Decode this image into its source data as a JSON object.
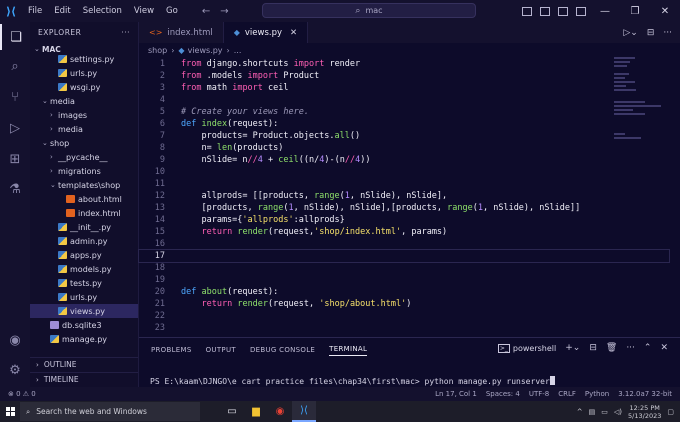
{
  "menu": [
    "File",
    "Edit",
    "Selection",
    "View",
    "Go"
  ],
  "search": {
    "placeholder": "mac"
  },
  "explorer": {
    "title": "EXPLORER",
    "root": "MAC",
    "items": [
      {
        "label": "settings.py",
        "indent": 2,
        "kind": "py"
      },
      {
        "label": "urls.py",
        "indent": 2,
        "kind": "py"
      },
      {
        "label": "wsgi.py",
        "indent": 2,
        "kind": "py"
      },
      {
        "label": "media",
        "indent": 1,
        "kind": "folder",
        "open": true
      },
      {
        "label": "images",
        "indent": 2,
        "kind": "folder",
        "open": false
      },
      {
        "label": "media",
        "indent": 2,
        "kind": "folder",
        "open": false
      },
      {
        "label": "shop",
        "indent": 1,
        "kind": "folder",
        "open": true
      },
      {
        "label": "__pycache__",
        "indent": 2,
        "kind": "folder",
        "open": false
      },
      {
        "label": "migrations",
        "indent": 2,
        "kind": "folder",
        "open": false
      },
      {
        "label": "templates\\shop",
        "indent": 2,
        "kind": "folder",
        "open": true
      },
      {
        "label": "about.html",
        "indent": 3,
        "kind": "html"
      },
      {
        "label": "index.html",
        "indent": 3,
        "kind": "html"
      },
      {
        "label": "__init__.py",
        "indent": 2,
        "kind": "py"
      },
      {
        "label": "admin.py",
        "indent": 2,
        "kind": "py"
      },
      {
        "label": "apps.py",
        "indent": 2,
        "kind": "py"
      },
      {
        "label": "models.py",
        "indent": 2,
        "kind": "py"
      },
      {
        "label": "tests.py",
        "indent": 2,
        "kind": "py"
      },
      {
        "label": "urls.py",
        "indent": 2,
        "kind": "py"
      },
      {
        "label": "views.py",
        "indent": 2,
        "kind": "py",
        "selected": true
      },
      {
        "label": "db.sqlite3",
        "indent": 1,
        "kind": "db"
      },
      {
        "label": "manage.py",
        "indent": 1,
        "kind": "py"
      }
    ],
    "outline": "OUTLINE",
    "timeline": "TIMELINE"
  },
  "tabs": [
    {
      "label": "index.html",
      "kind": "html",
      "active": false
    },
    {
      "label": "views.py",
      "kind": "py",
      "active": true
    }
  ],
  "breadcrumb": [
    "shop",
    "views.py",
    "..."
  ],
  "code": {
    "current_line": 17,
    "lines": [
      {
        "n": 1,
        "tokens": [
          [
            "kw",
            "from"
          ],
          [
            "tx",
            " django.shortcuts "
          ],
          [
            "kw",
            "import"
          ],
          [
            "tx",
            " render"
          ]
        ]
      },
      {
        "n": 2,
        "tokens": [
          [
            "kw",
            "from"
          ],
          [
            "tx",
            " .models "
          ],
          [
            "kw",
            "import"
          ],
          [
            "tx",
            " Product"
          ]
        ]
      },
      {
        "n": 3,
        "tokens": [
          [
            "kw",
            "from"
          ],
          [
            "tx",
            " math "
          ],
          [
            "kw",
            "import"
          ],
          [
            "tx",
            " ceil"
          ]
        ]
      },
      {
        "n": 4,
        "tokens": []
      },
      {
        "n": 5,
        "tokens": [
          [
            "cm",
            "# Create your views here."
          ]
        ]
      },
      {
        "n": 6,
        "tokens": [
          [
            "kw2",
            "def"
          ],
          [
            "tx",
            " "
          ],
          [
            "fn",
            "index"
          ],
          [
            "tx",
            "(request):"
          ]
        ]
      },
      {
        "n": 7,
        "tokens": [
          [
            "tx",
            "    products= Product.objects."
          ],
          [
            "fn",
            "all"
          ],
          [
            "tx",
            "()"
          ]
        ]
      },
      {
        "n": 8,
        "tokens": [
          [
            "tx",
            "    n= "
          ],
          [
            "fn",
            "len"
          ],
          [
            "tx",
            "(products)"
          ]
        ]
      },
      {
        "n": 9,
        "tokens": [
          [
            "tx",
            "    nSlide= n"
          ],
          [
            "op",
            "//"
          ],
          [
            "nm",
            "4"
          ],
          [
            "tx",
            " + "
          ],
          [
            "fn",
            "ceil"
          ],
          [
            "tx",
            "((n/"
          ],
          [
            "nm",
            "4"
          ],
          [
            "tx",
            ")-(n"
          ],
          [
            "op",
            "//"
          ],
          [
            "nm",
            "4"
          ],
          [
            "tx",
            "))"
          ]
        ]
      },
      {
        "n": 10,
        "tokens": []
      },
      {
        "n": 11,
        "tokens": []
      },
      {
        "n": 12,
        "tokens": [
          [
            "tx",
            "    allprods= [[products, "
          ],
          [
            "fn",
            "range"
          ],
          [
            "tx",
            "("
          ],
          [
            "nm",
            "1"
          ],
          [
            "tx",
            ", nSlide), nSlide],"
          ]
        ]
      },
      {
        "n": 13,
        "tokens": [
          [
            "tx",
            "    [products, "
          ],
          [
            "fn",
            "range"
          ],
          [
            "tx",
            "("
          ],
          [
            "nm",
            "1"
          ],
          [
            "tx",
            ", nSlide), nSlide],[products, "
          ],
          [
            "fn",
            "range"
          ],
          [
            "tx",
            "("
          ],
          [
            "nm",
            "1"
          ],
          [
            "tx",
            ", nSlide), nSlide]]"
          ]
        ]
      },
      {
        "n": 14,
        "tokens": [
          [
            "tx",
            "    params={"
          ],
          [
            "st",
            "'allprods'"
          ],
          [
            "tx",
            ":allprods}"
          ]
        ]
      },
      {
        "n": 15,
        "tokens": [
          [
            "tx",
            "    "
          ],
          [
            "kw",
            "return"
          ],
          [
            "tx",
            " "
          ],
          [
            "fn",
            "render"
          ],
          [
            "tx",
            "(request,"
          ],
          [
            "st",
            "'shop/index.html'"
          ],
          [
            "tx",
            ", params)"
          ]
        ]
      },
      {
        "n": 16,
        "tokens": []
      },
      {
        "n": 17,
        "tokens": []
      },
      {
        "n": 18,
        "tokens": []
      },
      {
        "n": 19,
        "tokens": []
      },
      {
        "n": 20,
        "tokens": [
          [
            "kw2",
            "def"
          ],
          [
            "tx",
            " "
          ],
          [
            "fn",
            "about"
          ],
          [
            "tx",
            "(request):"
          ]
        ]
      },
      {
        "n": 21,
        "tokens": [
          [
            "tx",
            "    "
          ],
          [
            "kw",
            "return"
          ],
          [
            "tx",
            " "
          ],
          [
            "fn",
            "render"
          ],
          [
            "tx",
            "(request, "
          ],
          [
            "st",
            "'shop/about.html'"
          ],
          [
            "tx",
            ")"
          ]
        ]
      },
      {
        "n": 22,
        "tokens": []
      },
      {
        "n": 23,
        "tokens": []
      }
    ]
  },
  "panel": {
    "tabs": [
      "PROBLEMS",
      "OUTPUT",
      "DEBUG CONSOLE",
      "TERMINAL"
    ],
    "active_tab": "TERMINAL",
    "shell": "powershell",
    "prompt": "PS E:\\kaam\\DJNGO\\e cart practice files\\chap34\\first\\mac> python manage.py runserver"
  },
  "status": {
    "left": "⊗ 0 ⚠ 0",
    "right": [
      "Ln 17, Col 1",
      "Spaces: 4",
      "UTF-8",
      "CRLF",
      "Python",
      "3.12.0a7 32-bit"
    ]
  },
  "taskbar": {
    "search_placeholder": "Search the web and Windows",
    "time": "12:25 PM",
    "date": "5/13/2023"
  }
}
